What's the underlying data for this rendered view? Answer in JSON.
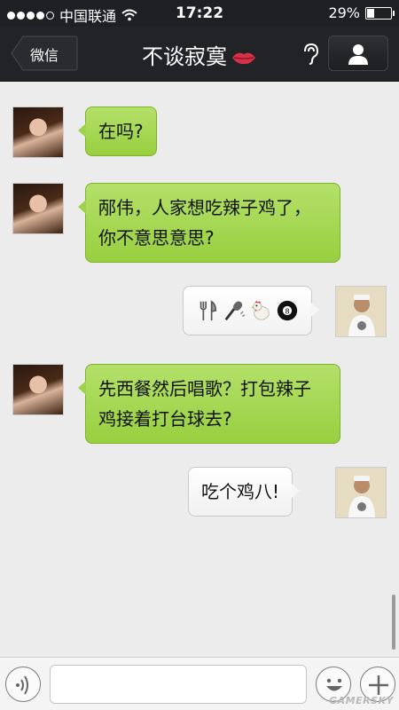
{
  "status_bar": {
    "carrier": "中国联通",
    "time": "17:22",
    "battery_text": "29%",
    "battery_level": 0.29,
    "signal_bars": 4,
    "signal_total": 5
  },
  "nav": {
    "back_label": "微信",
    "title": "不谈寂寞",
    "title_icon": "lips-emoji",
    "ear_icon": "earpiece-mode-icon",
    "profile_icon": "person-icon"
  },
  "messages": [
    {
      "side": "in",
      "text": "在吗?"
    },
    {
      "side": "in",
      "text": "邴伟，人家想吃辣子鸡了，你不意思意思?"
    },
    {
      "side": "out",
      "emojis": [
        "fork-knife",
        "microphone",
        "rooster",
        "billiard-8-ball"
      ]
    },
    {
      "side": "in",
      "text": "先西餐然后唱歌？打包辣子鸡接着打台球去?"
    },
    {
      "side": "out",
      "text": "吃个鸡八!"
    }
  ],
  "input_bar": {
    "input_value": "",
    "voice_icon": "voice-icon",
    "emoji_icon": "smiley-face-icon",
    "plus_icon": "plus-icon"
  },
  "colors": {
    "incoming_bubble": "#a6d853",
    "outgoing_bubble": "#ffffff",
    "nav_background": "#222327"
  },
  "watermark": "GAMERSKY"
}
